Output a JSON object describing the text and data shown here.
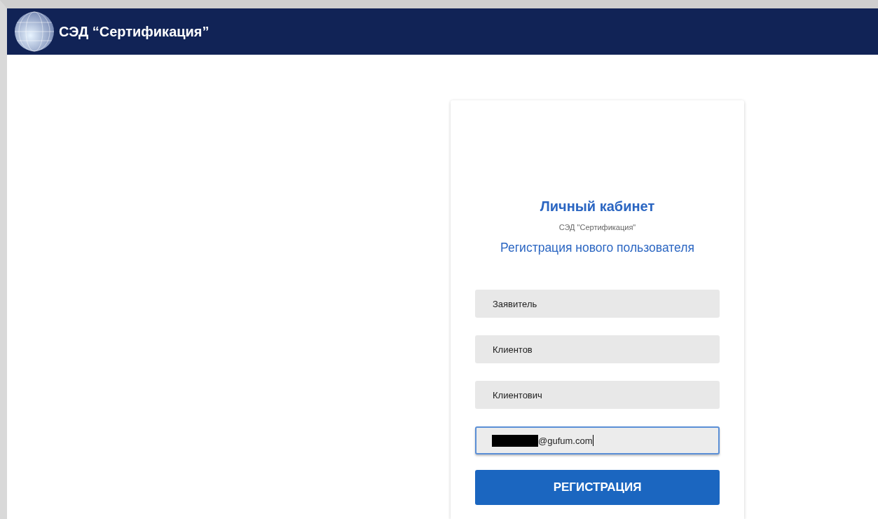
{
  "header": {
    "title": "СЭД “Сертификация”"
  },
  "card": {
    "title": "Личный кабинет",
    "subtitle": "СЭД \"Сертификация\"",
    "heading": "Регистрация нового пользователя",
    "fields": [
      {
        "kind": "text",
        "value": "Заявитель",
        "focused": false
      },
      {
        "kind": "text",
        "value": "Клиентов",
        "focused": false
      },
      {
        "kind": "text",
        "value": "Клиентович",
        "focused": false
      },
      {
        "kind": "redacted",
        "value": "@gufum.com",
        "focused": true
      }
    ],
    "button": "РЕГИСТРАЦИЯ"
  }
}
